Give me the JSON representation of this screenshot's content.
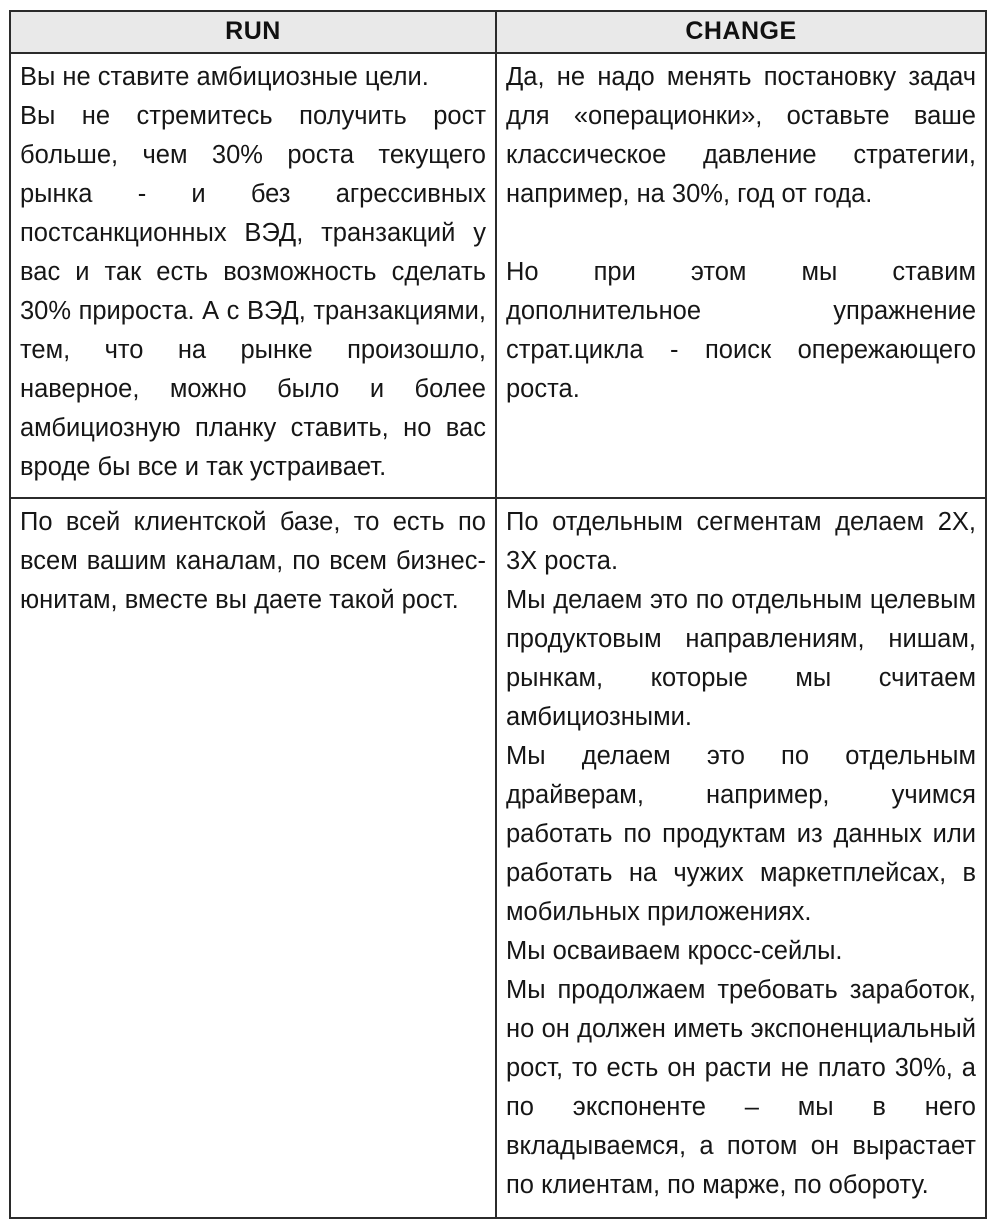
{
  "document": {
    "type": "two-column comparison table",
    "language": "ru"
  },
  "table": {
    "columns": [
      {
        "id": "run",
        "header": "RUN"
      },
      {
        "id": "change",
        "header": "CHANGE"
      }
    ],
    "header_background": "#e9e9e9",
    "border_color": "#2b2b2b",
    "text_color": "#161616",
    "rows": [
      {
        "id": "row-1",
        "run": {
          "paragraphs": [
            "Вы не ставите амбициозные цели.",
            "Вы не стремитесь получить рост больше, чем 30% роста текущего рынка - и без агрессивных постсанкционных ВЭД, транзакций у вас и так есть возможность сделать 30% прироста. А с ВЭД, транзакциями, тем, что на рынке произошло, наверное, можно было и более амбициозную планку ставить, но вас вроде бы все и так устраивает."
          ]
        },
        "change": {
          "paragraphs": [
            "Да, не надо менять постановку задач для «операционки», оставьте ваше классическое давление стратегии, например, на 30%, год от года.",
            "Но при этом мы ставим дополнительное упражнение страт.цикла - поиск опережающего роста."
          ],
          "blank_line_after_paragraph_index": 0
        }
      },
      {
        "id": "row-2",
        "run": {
          "paragraphs": [
            "По всей клиентской базе, то есть по всем вашим каналам, по всем бизнес-юнитам, вместе вы даете такой рост."
          ]
        },
        "change": {
          "paragraphs": [
            "По отдельным сегментам делаем 2Х, 3Х роста.",
            "Мы делаем это по отдельным целевым продуктовым направлениям, нишам, рынкам, которые мы считаем амбициозными.",
            "Мы делаем это по отдельным драйверам, например, учимся работать по продуктам из данных или работать на чужих маркетплейсах, в мобильных приложениях.",
            "Мы осваиваем кросс-сейлы.",
            "Мы продолжаем требовать заработок, но он должен иметь экспоненциальный рост, то есть он расти не плато 30%, а по экспоненте – мы в него вкладываемся, а потом он вырастает по клиентам, по марже, по обороту."
          ]
        }
      }
    ]
  }
}
